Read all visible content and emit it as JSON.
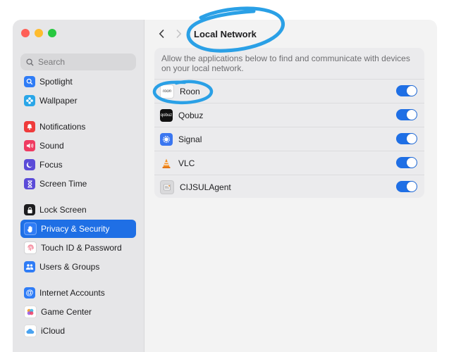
{
  "sidebar": {
    "search_placeholder": "Search",
    "items": [
      {
        "label": "Spotlight",
        "icon": "spotlight-icon",
        "color": "#2f7cf6"
      },
      {
        "label": "Wallpaper",
        "icon": "wallpaper-icon",
        "color": "#2aa6e8"
      },
      {
        "label": "Notifications",
        "icon": "bell-icon",
        "color": "#ef3b3b"
      },
      {
        "label": "Sound",
        "icon": "speaker-icon",
        "color": "#ef3b61"
      },
      {
        "label": "Focus",
        "icon": "moon-icon",
        "color": "#5b4bd8"
      },
      {
        "label": "Screen Time",
        "icon": "hourglass-icon",
        "color": "#5b4bd8"
      },
      {
        "label": "Lock Screen",
        "icon": "lock-icon",
        "color": "#1d1d1f"
      },
      {
        "label": "Privacy & Security",
        "icon": "hand-icon",
        "color": "#2f7cf6"
      },
      {
        "label": "Touch ID & Password",
        "icon": "fingerprint-icon",
        "color": "#ffffff"
      },
      {
        "label": "Users & Groups",
        "icon": "users-icon",
        "color": "#2f7cf6"
      },
      {
        "label": "Internet Accounts",
        "icon": "at-icon",
        "color": "#2f7cf6"
      },
      {
        "label": "Game Center",
        "icon": "game-center-icon",
        "color": "#e9468f"
      },
      {
        "label": "iCloud",
        "icon": "cloud-icon",
        "color": "#ffffff"
      }
    ],
    "selected": "Privacy & Security"
  },
  "header": {
    "title": "Local Network"
  },
  "panel": {
    "description": "Allow the applications below to find and communicate with devices on your local network.",
    "apps": [
      {
        "name": "Roon",
        "icon": "roon-icon",
        "icon_text": "roon",
        "enabled": true
      },
      {
        "name": "Qobuz",
        "icon": "qobuz-icon",
        "icon_text": "qobuz",
        "enabled": true
      },
      {
        "name": "Signal",
        "icon": "signal-icon",
        "icon_text": "",
        "enabled": true
      },
      {
        "name": "VLC",
        "icon": "vlc-icon",
        "icon_text": "",
        "enabled": true
      },
      {
        "name": "CIJSULAgent",
        "icon": "cijsul-agent-icon",
        "icon_text": "",
        "enabled": true
      }
    ]
  },
  "colors": {
    "accent": "#1f6fe5",
    "annotation": "#2aa0e6"
  }
}
